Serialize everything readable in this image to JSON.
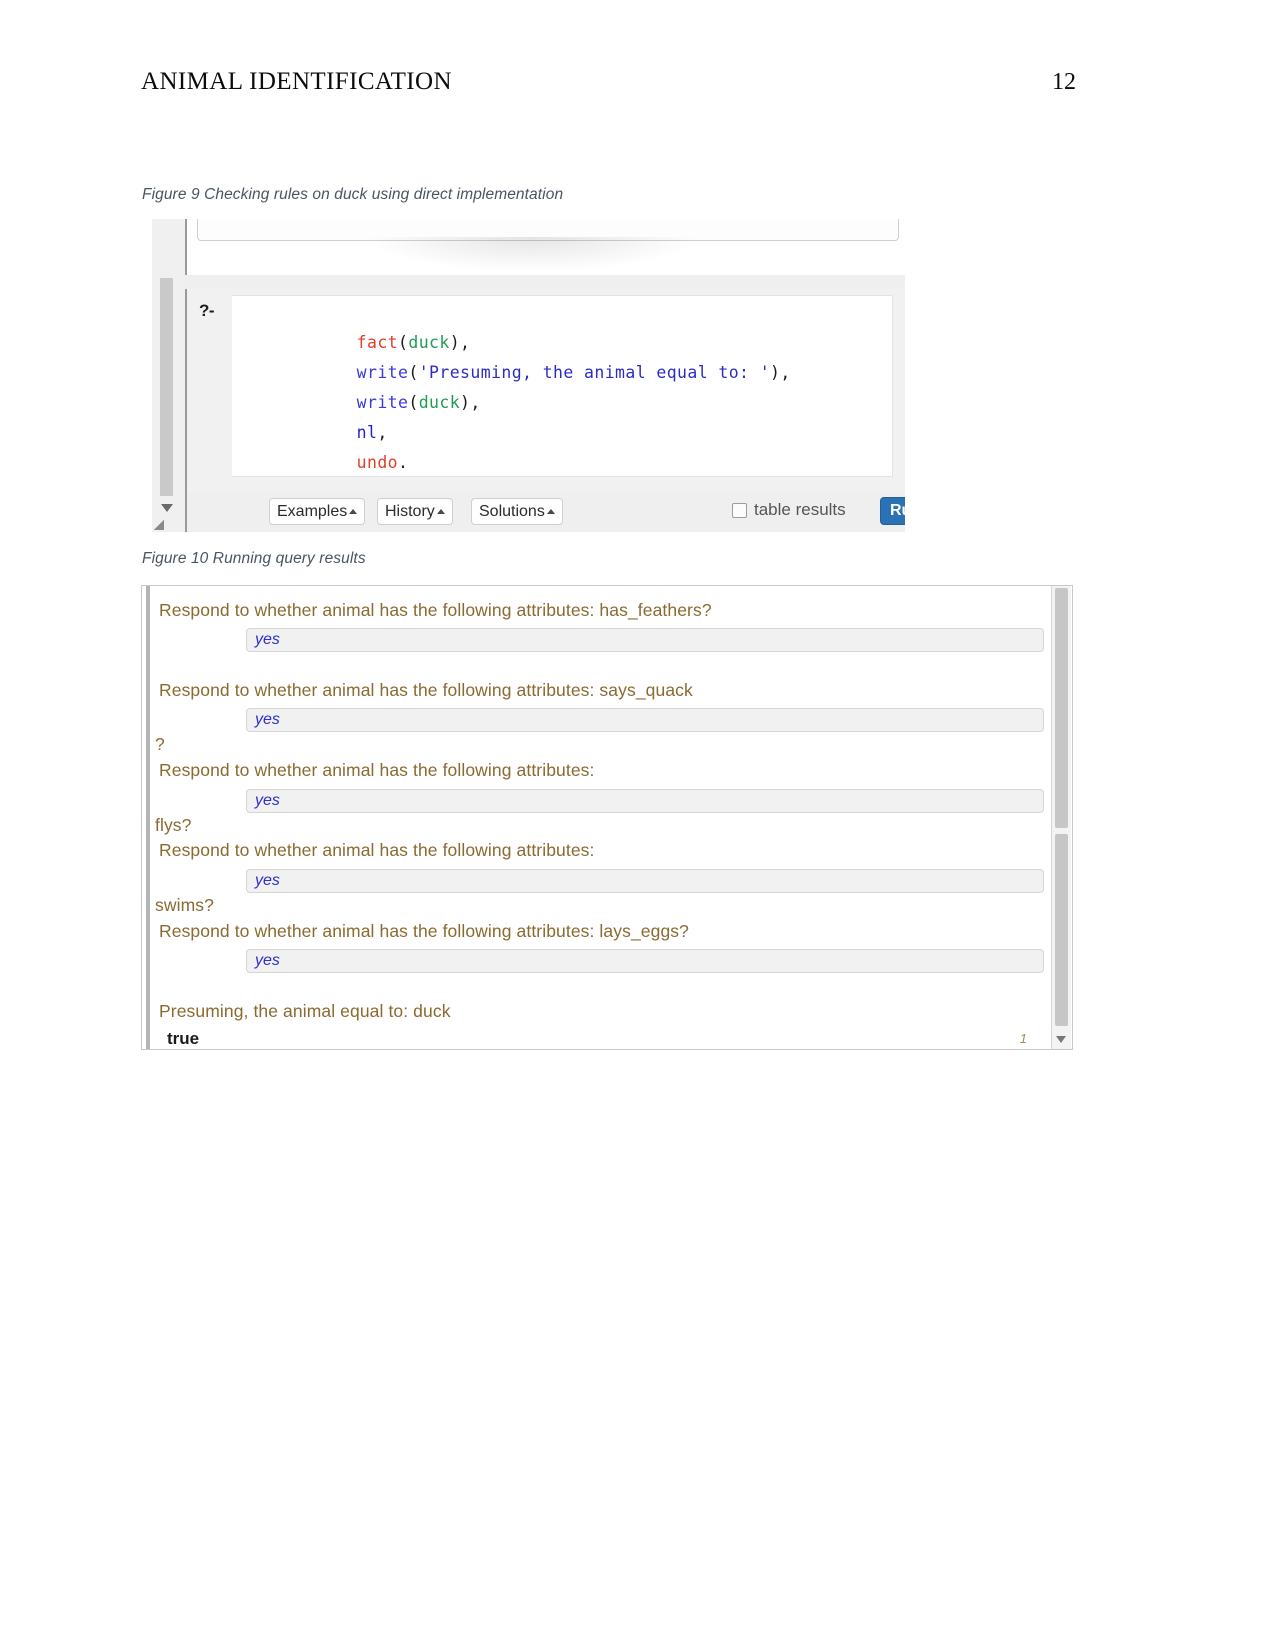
{
  "header": {
    "title": "ANIMAL IDENTIFICATION",
    "page_number": "12"
  },
  "figures": [
    {
      "caption": "Figure 9 Checking rules on duck using direct implementation"
    },
    {
      "caption": "Figure 10 Running query results"
    }
  ],
  "figure9": {
    "prompt": "?-",
    "code_lines": [
      {
        "pred": "fact",
        "open": "(",
        "arg": "duck",
        "close": "),",
        "kind": "call"
      },
      {
        "pred": "write",
        "open": "(",
        "arg": "'Presuming, the animal equal to: '",
        "close": "),",
        "kind": "string"
      },
      {
        "pred": "write",
        "open": "(",
        "arg": "duck",
        "close": "),",
        "kind": "call"
      },
      {
        "pred": "nl",
        "open": "",
        "arg": "",
        "close": ",",
        "kind": "bare"
      },
      {
        "pred": "undo",
        "open": "",
        "arg": "",
        "close": ".",
        "kind": "bare"
      }
    ],
    "toolbar": {
      "examples_label": "Examples",
      "history_label": "History",
      "solutions_label": "Solutions",
      "table_results_label": "table results",
      "table_results_checked": false,
      "run_label": "Run!"
    },
    "colors": {
      "predicate_red": "#e0402b",
      "predicate_blue": "#3b3bd6",
      "atom_green": "#1f9e52",
      "run_button_blue": "#2a72b5"
    }
  },
  "figure10": {
    "output": [
      {
        "type": "question",
        "text": "Respond to whether animal has the following attributes: has_feathers?"
      },
      {
        "type": "answer",
        "text": "yes"
      },
      {
        "type": "question",
        "text": "Respond to whether animal has the following attributes: says_quack"
      },
      {
        "type": "answer",
        "text": "yes"
      },
      {
        "type": "fragment",
        "text": "?"
      },
      {
        "type": "question",
        "text": "Respond to whether animal has the following attributes:"
      },
      {
        "type": "answer",
        "text": "yes"
      },
      {
        "type": "fragment",
        "text": "flys?"
      },
      {
        "type": "question",
        "text": "Respond to whether animal has the following attributes:"
      },
      {
        "type": "answer",
        "text": "yes"
      },
      {
        "type": "fragment",
        "text": "swims?"
      },
      {
        "type": "question",
        "text": "Respond to whether animal has the following attributes: lays_eggs?"
      },
      {
        "type": "answer",
        "text": "yes"
      },
      {
        "type": "result",
        "text": "Presuming, the animal equal to: duck"
      },
      {
        "type": "true",
        "text": "true"
      }
    ],
    "solution_count": "1",
    "colors": {
      "question_brown": "#8a6a30",
      "answer_blue": "#2f2fd0"
    }
  }
}
